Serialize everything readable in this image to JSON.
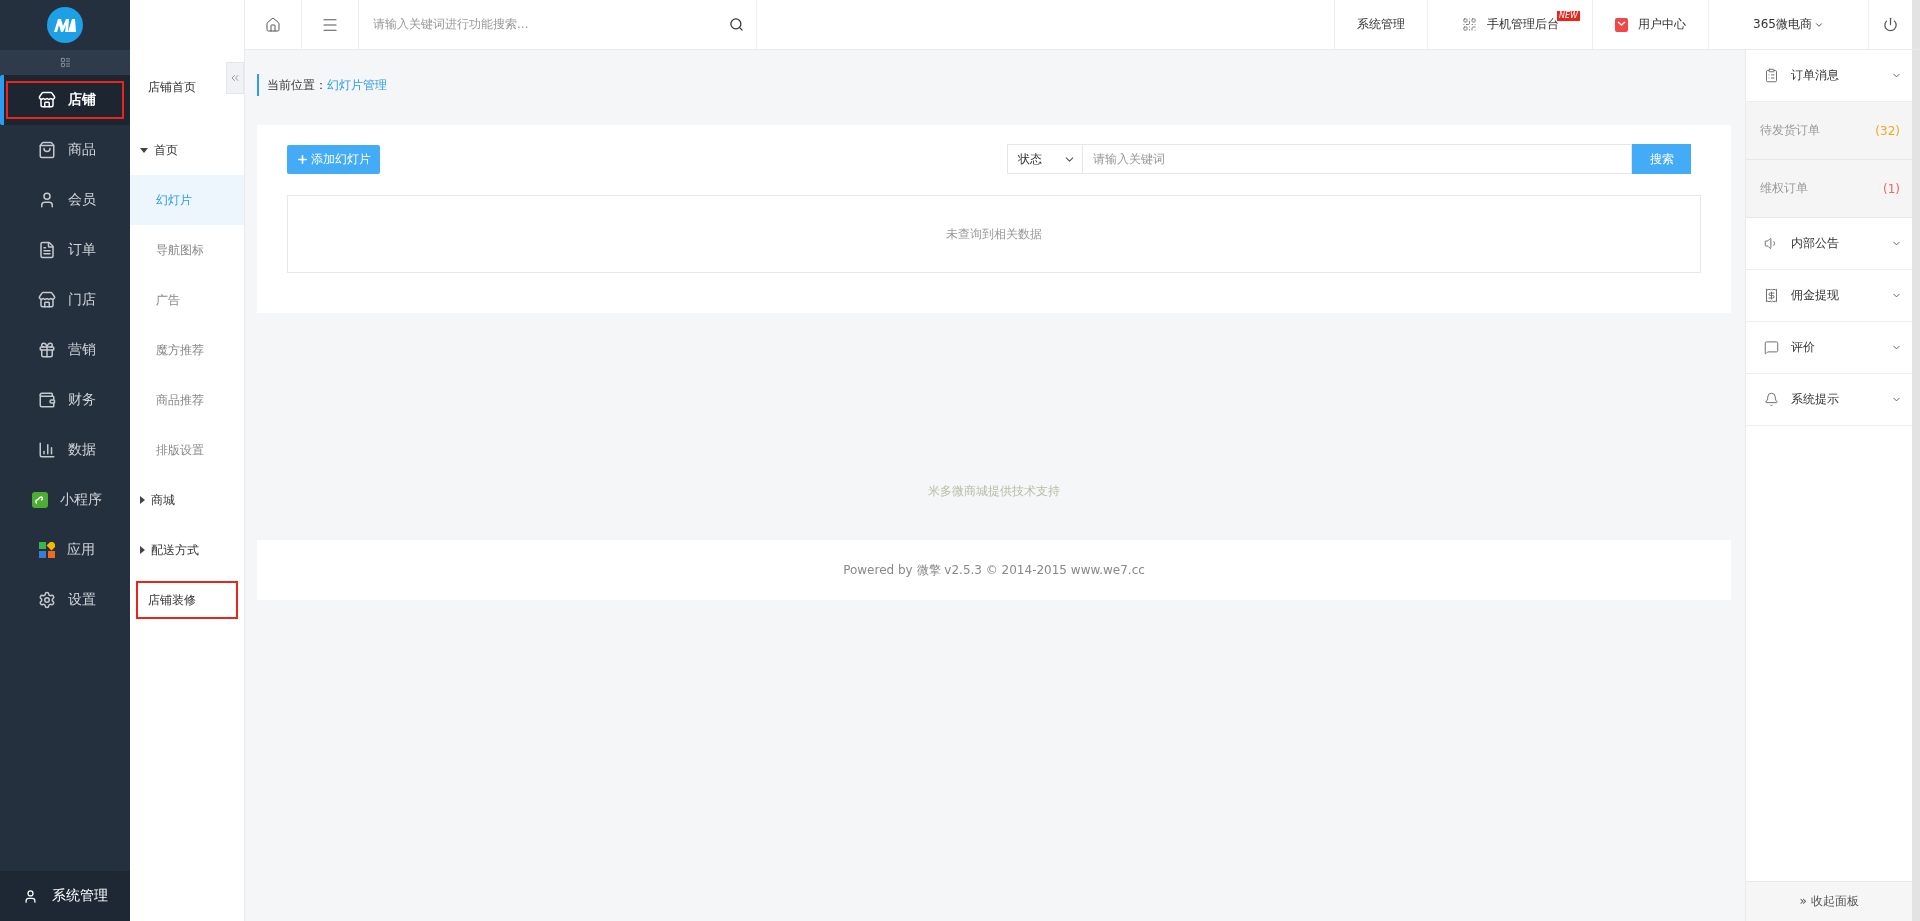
{
  "sidebar": {
    "items": [
      {
        "kind": "store",
        "label": "店铺",
        "selected": true,
        "highlighted": true
      },
      {
        "kind": "bag",
        "label": "商品",
        "selected": false,
        "highlighted": false
      },
      {
        "kind": "person",
        "label": "会员",
        "selected": false,
        "highlighted": false
      },
      {
        "kind": "document",
        "label": "订单",
        "selected": false,
        "highlighted": false
      },
      {
        "kind": "shopfront",
        "label": "门店",
        "selected": false,
        "highlighted": false
      },
      {
        "kind": "gift",
        "label": "营销",
        "selected": false,
        "highlighted": false
      },
      {
        "kind": "money",
        "label": "财务",
        "selected": false,
        "highlighted": false
      },
      {
        "kind": "chart",
        "label": "数据",
        "selected": false,
        "highlighted": false
      },
      {
        "kind": "mini",
        "label": "小程序",
        "selected": false,
        "highlighted": false
      },
      {
        "kind": "tiles",
        "label": "应用",
        "selected": false,
        "highlighted": false
      },
      {
        "kind": "gear",
        "label": "设置",
        "selected": false,
        "highlighted": false
      }
    ],
    "footer_item": {
      "label": "系统管理"
    }
  },
  "subnav": {
    "title": "店铺首页",
    "items": [
      {
        "kind": "group",
        "label": "首页",
        "expanded": true,
        "selected": false,
        "highlighted": false
      },
      {
        "kind": "link",
        "label": "幻灯片",
        "selected": true,
        "highlighted": false
      },
      {
        "kind": "link",
        "label": "导航图标",
        "selected": false,
        "highlighted": false
      },
      {
        "kind": "link",
        "label": "广告",
        "selected": false,
        "highlighted": false
      },
      {
        "kind": "link",
        "label": "魔方推荐",
        "selected": false,
        "highlighted": false
      },
      {
        "kind": "link",
        "label": "商品推荐",
        "selected": false,
        "highlighted": false
      },
      {
        "kind": "link",
        "label": "排版设置",
        "selected": false,
        "highlighted": false
      },
      {
        "kind": "group",
        "label": "商城",
        "expanded": false,
        "selected": false,
        "highlighted": false
      },
      {
        "kind": "group",
        "label": "配送方式",
        "expanded": false,
        "selected": false,
        "highlighted": false
      },
      {
        "kind": "top",
        "label": "店铺装修",
        "selected": false,
        "highlighted": true
      }
    ]
  },
  "topbar": {
    "search_placeholder": "请输入关键词进行功能搜索...",
    "links": [
      {
        "kind": "plain",
        "label": "系统管理"
      },
      {
        "kind": "qr",
        "label": "手机管理后台",
        "badge": "NEW"
      },
      {
        "kind": "bag",
        "label": "用户中心"
      },
      {
        "kind": "dropdown",
        "label": "365微电商"
      }
    ]
  },
  "main": {
    "breadcrumb": {
      "prefix": "当前位置：",
      "current": "幻灯片管理"
    },
    "add_button": "添加幻灯片",
    "status_select": "状态",
    "keyword_placeholder": "请输入关键词",
    "search_button": "搜索",
    "empty_message": "未查询到相关数据",
    "support_text": "米多微商城提供技术支持",
    "footer": "Powered by 微擎 v2.5.3 © 2014-2015 www.we7.cc"
  },
  "right_panel": {
    "sections": [
      {
        "kind": "clipboard",
        "label": "订单消息",
        "entries": [
          {
            "label": "待发货订单",
            "count": "(32)",
            "color": "#f5a623"
          },
          {
            "label": "维权订单",
            "count": "(1)",
            "color": "#ee6666"
          }
        ]
      },
      {
        "kind": "speaker",
        "label": "内部公告"
      },
      {
        "kind": "wallet",
        "label": "佣金提现"
      },
      {
        "kind": "comment",
        "label": "评价"
      },
      {
        "kind": "bell",
        "label": "系统提示"
      }
    ],
    "collapse": "» 收起面板"
  }
}
